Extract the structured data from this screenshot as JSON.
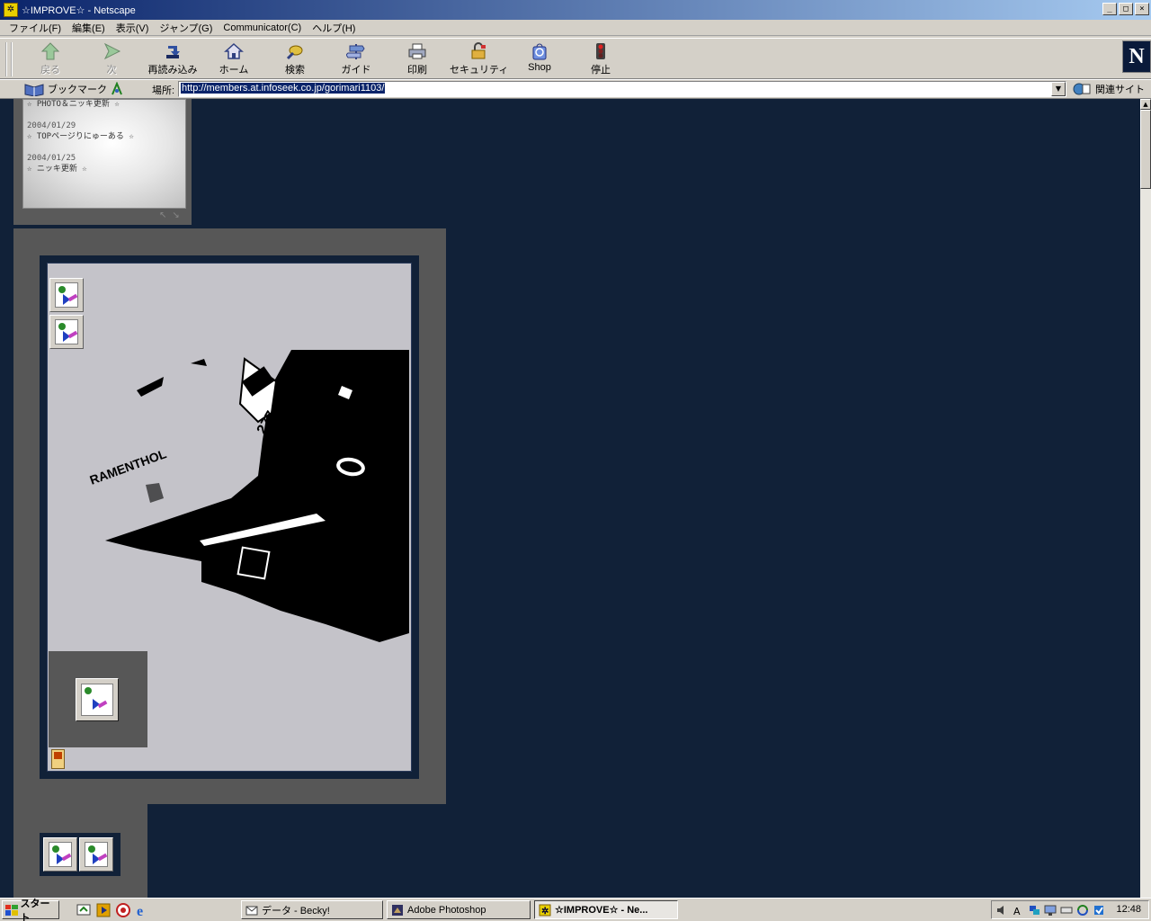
{
  "window": {
    "title": "☆IMPROVE☆ - Netscape",
    "min": "_",
    "max": "□",
    "close": "×"
  },
  "menu": [
    "ファイル(F)",
    "編集(E)",
    "表示(V)",
    "ジャンプ(G)",
    "Communicator(C)",
    "ヘルプ(H)"
  ],
  "toolbar": {
    "back": "戻る",
    "forward": "次",
    "reload": "再読み込み",
    "home": "ホーム",
    "search": "検索",
    "guide": "ガイド",
    "print": "印刷",
    "security": "セキュリティ",
    "shop": "Shop",
    "stop": "停止",
    "logo": "N"
  },
  "location": {
    "bookmarks": "ブックマーク",
    "label": "場所:",
    "url": "http://members.at.infoseek.co.jp/gorimari1103/",
    "related": "関連サイト"
  },
  "news": [
    {
      "text": "☆ PHOTO＆ニッキ更新 ☆"
    },
    {
      "date": "2004/01/29",
      "text": "☆ TOPページりにゅーある ☆"
    },
    {
      "date": "2004/01/25",
      "text": "☆ ニッキ更新 ☆"
    }
  ],
  "photo": {
    "text": "RAMENTHOL"
  },
  "taskbar": {
    "start": "スタート",
    "tasks": [
      "データ - Becky!",
      "Adobe Photoshop",
      "☆IMPROVE☆ - Ne..."
    ],
    "clock": "12:48"
  },
  "colors": {
    "page_bg": "#112138",
    "panel": "#575757",
    "frame_bg": "#c4c3c9",
    "titlebar": "#0a246a"
  }
}
